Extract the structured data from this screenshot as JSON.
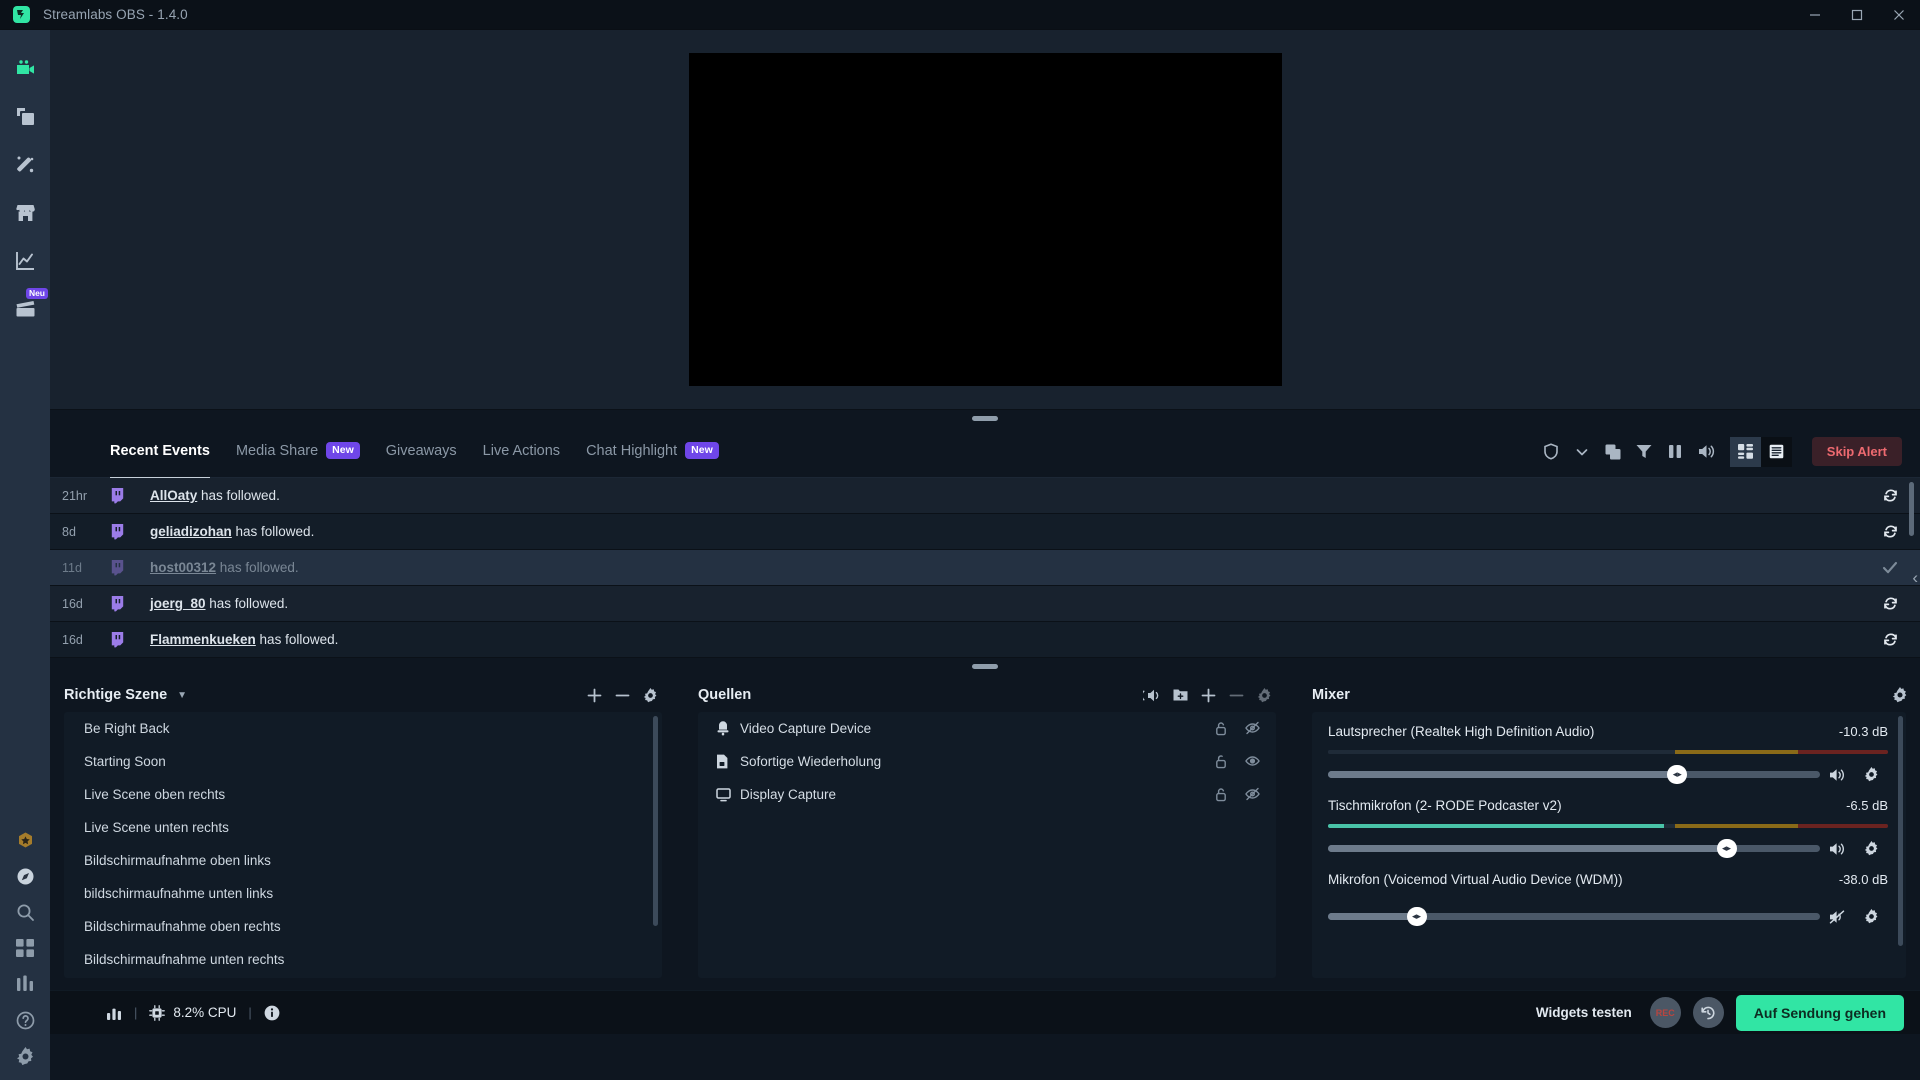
{
  "window": {
    "title": "Streamlabs OBS - 1.4.0",
    "app_icon": "streamlabs-icon",
    "minimize": "minimize-icon",
    "maximize": "maximize-icon",
    "close": "close-icon"
  },
  "sidebar": {
    "items": [
      {
        "name": "editor",
        "icon": "video-camera-icon",
        "active": true,
        "badge": ""
      },
      {
        "name": "themes",
        "icon": "layers-icon",
        "active": false,
        "badge": ""
      },
      {
        "name": "alertbox",
        "icon": "magic-wand-icon",
        "active": false,
        "badge": ""
      },
      {
        "name": "store",
        "icon": "store-icon",
        "active": false,
        "badge": ""
      },
      {
        "name": "dashboard",
        "icon": "analytics-chart-icon",
        "active": false,
        "badge": ""
      },
      {
        "name": "highlighter",
        "icon": "clapperboard-icon",
        "active": false,
        "badge": "Neu"
      }
    ],
    "bottom_items": [
      {
        "name": "prime",
        "icon": "prime-badge-icon"
      },
      {
        "name": "help-circle",
        "icon": "compass-icon"
      },
      {
        "name": "search",
        "icon": "search-icon"
      },
      {
        "name": "layout",
        "icon": "grid-icon"
      },
      {
        "name": "stats",
        "icon": "bars-icon"
      },
      {
        "name": "help",
        "icon": "question-circle-icon"
      },
      {
        "name": "settings",
        "icon": "gear-icon"
      }
    ]
  },
  "preview": {
    "label": "stream-preview-canvas"
  },
  "events": {
    "tabs": [
      {
        "label": "Recent Events",
        "badge": "",
        "active": true
      },
      {
        "label": "Media Share",
        "badge": "New",
        "active": false
      },
      {
        "label": "Giveaways",
        "badge": "",
        "active": false
      },
      {
        "label": "Live Actions",
        "badge": "",
        "active": false
      },
      {
        "label": "Chat Highlight",
        "badge": "New",
        "active": false
      }
    ],
    "tools": [
      {
        "name": "shield-icon"
      },
      {
        "name": "chevron-down-icon"
      },
      {
        "name": "duplicate-icon"
      },
      {
        "name": "filter-icon"
      },
      {
        "name": "pause-icon"
      },
      {
        "name": "volume-icon"
      }
    ],
    "view_grid": "grid-view-icon",
    "view_list": "list-view-icon",
    "skip_alert": "Skip Alert",
    "rows": [
      {
        "time": "21hr",
        "platform": "twitch-icon",
        "user": "AllOaty",
        "text": " has followed.",
        "action": "replay-icon",
        "state": "normal"
      },
      {
        "time": "8d",
        "platform": "twitch-icon",
        "user": "geliadizohan",
        "text": " has followed.",
        "action": "replay-icon",
        "state": "normal"
      },
      {
        "time": "11d",
        "platform": "twitch-icon",
        "user": "host00312",
        "text": " has followed.",
        "action": "check-icon",
        "state": "dim"
      },
      {
        "time": "16d",
        "platform": "twitch-icon",
        "user": "joerg_80",
        "text": " has followed.",
        "action": "replay-icon",
        "state": "normal"
      },
      {
        "time": "16d",
        "platform": "twitch-icon",
        "user": "Flammenkueken",
        "text": " has followed.",
        "action": "replay-icon",
        "state": "normal"
      }
    ]
  },
  "scenes": {
    "title": "Richtige Szene",
    "caret": "chevron-down-icon",
    "tools": [
      {
        "name": "add-scene-icon"
      },
      {
        "name": "remove-scene-icon"
      },
      {
        "name": "scene-settings-icon"
      }
    ],
    "items": [
      {
        "label": "Be Right Back"
      },
      {
        "label": "Starting Soon"
      },
      {
        "label": "Live Scene oben rechts"
      },
      {
        "label": "Live Scene unten rechts"
      },
      {
        "label": "Bildschirmaufnahme oben links"
      },
      {
        "label": "bildschirmaufnahme unten links"
      },
      {
        "label": "Bildschirmaufnahme oben rechts"
      },
      {
        "label": "Bildschirmaufnahme unten rechts"
      }
    ]
  },
  "sources": {
    "title": "Quellen",
    "tools": [
      {
        "name": "audio-mix-icon"
      },
      {
        "name": "add-folder-icon"
      },
      {
        "name": "add-source-icon"
      },
      {
        "name": "remove-source-icon"
      },
      {
        "name": "source-settings-icon"
      }
    ],
    "items": [
      {
        "label": "Video Capture Device",
        "icon": "camera-icon",
        "lock": "unlock-icon",
        "visibility": "eye-off-icon"
      },
      {
        "label": "Sofortige Wiederholung",
        "icon": "file-icon",
        "lock": "unlock-icon",
        "visibility": "eye-icon"
      },
      {
        "label": "Display Capture",
        "icon": "monitor-icon",
        "lock": "unlock-icon",
        "visibility": "eye-off-icon"
      }
    ]
  },
  "mixer": {
    "title": "Mixer",
    "settings_icon": "gear-icon",
    "channels": [
      {
        "name": "Lautsprecher (Realtek High Definition Audio)",
        "db": "-10.3 dB",
        "meter_green_pct": 0,
        "meter_yellow_pct": 62,
        "meter_yellow_end_pct": 84,
        "volume_pct": 71,
        "muted": false,
        "mute_icon": "volume-icon",
        "settings_icon": "gear-icon"
      },
      {
        "name": "Tischmikrofon (2- RODE Podcaster v2)",
        "db": "-6.5 dB",
        "meter_green_pct": 60,
        "meter_yellow_pct": 62,
        "meter_yellow_end_pct": 84,
        "volume_pct": 81,
        "muted": false,
        "mute_icon": "volume-icon",
        "settings_icon": "gear-icon"
      },
      {
        "name": "Mikrofon (Voicemod Virtual Audio Device (WDM))",
        "db": "-38.0 dB",
        "meter_green_pct": 0,
        "meter_yellow_pct": 0,
        "meter_yellow_end_pct": 0,
        "volume_pct": 18,
        "muted": true,
        "mute_icon": "volume-muted-icon",
        "settings_icon": "gear-icon"
      }
    ]
  },
  "statusbar": {
    "stats_icon": "bar-chart-icon",
    "cpu_icon": "cpu-chip-icon",
    "cpu": "8.2% CPU",
    "info_icon": "info-icon",
    "separator": "|",
    "widgets_test": "Widgets testen",
    "rec_label": "REC",
    "replay_icon": "replay-icon",
    "go_live": "Auf Sendung gehen"
  },
  "colors": {
    "accent": "#31e5a4",
    "badge_purple": "#6f46e8",
    "skip_alert": "#ee6a70",
    "twitch": "#9b7ce8",
    "sidebar_bg": "#243142",
    "panel_bg": "#111b26",
    "app_bg": "#0e1620"
  }
}
